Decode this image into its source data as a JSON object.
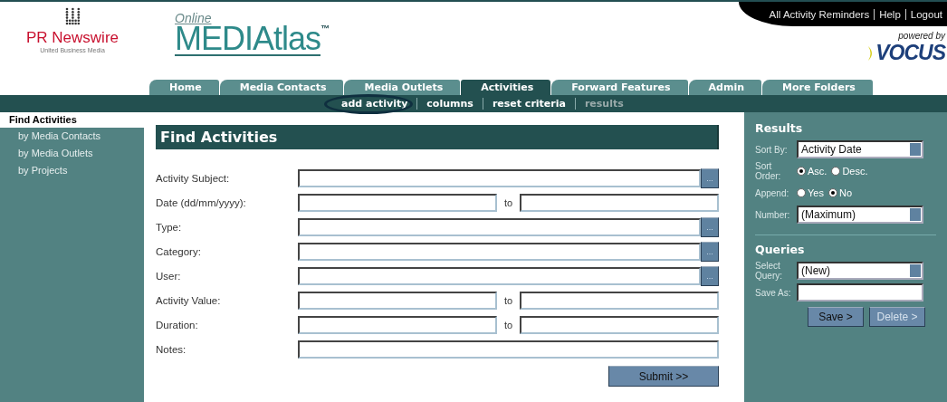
{
  "brand": {
    "company": "PR Newswire",
    "company_sub": "United Business Media",
    "product_prefix": "Online",
    "product_name": "MEDIAtlas",
    "trademark": "™",
    "powered_by": "powered by",
    "partner": "VOCUS"
  },
  "top_links": [
    "All Activity Reminders",
    "Help",
    "Logout"
  ],
  "tabs": [
    {
      "label": "Home",
      "selected": false
    },
    {
      "label": "Media Contacts",
      "selected": false
    },
    {
      "label": "Media Outlets",
      "selected": false
    },
    {
      "label": "Activities",
      "selected": true
    },
    {
      "label": "Forward Features",
      "selected": false
    },
    {
      "label": "Admin",
      "selected": false
    },
    {
      "label": "More Folders",
      "selected": false
    }
  ],
  "subnav": [
    {
      "label": "add activity",
      "disabled": false,
      "highlighted": true
    },
    {
      "label": "columns",
      "disabled": false,
      "highlighted": false
    },
    {
      "label": "reset criteria",
      "disabled": false,
      "highlighted": false
    },
    {
      "label": "results",
      "disabled": true,
      "highlighted": false
    }
  ],
  "sidebar": {
    "title": "Find Activities",
    "items": [
      "by Media Contacts",
      "by Media Outlets",
      "by Projects"
    ]
  },
  "form": {
    "title": "Find Activities",
    "rows": [
      {
        "kind": "lookup",
        "label": "Activity Subject:",
        "lookup": "..."
      },
      {
        "kind": "range",
        "label": "Date (dd/mm/yyyy):",
        "joiner": "to"
      },
      {
        "kind": "lookup",
        "label": "Type:",
        "lookup": "..."
      },
      {
        "kind": "lookup",
        "label": "Category:",
        "lookup": "..."
      },
      {
        "kind": "lookup",
        "label": "User:",
        "lookup": "..."
      },
      {
        "kind": "range",
        "label": "Activity Value:",
        "joiner": "to"
      },
      {
        "kind": "range",
        "label": "Duration:",
        "joiner": "to"
      },
      {
        "kind": "text",
        "label": "Notes:"
      }
    ],
    "submit": "Submit >>"
  },
  "results": {
    "title": "Results",
    "rows": [
      {
        "kind": "select",
        "label": "Sort By:",
        "value": "Activity Date"
      },
      {
        "kind": "radio",
        "label": "Sort Order:",
        "options": [
          {
            "label": "Asc.",
            "selected": true
          },
          {
            "label": "Desc.",
            "selected": false
          }
        ]
      },
      {
        "kind": "radio",
        "label": "Append:",
        "options": [
          {
            "label": "Yes",
            "selected": false
          },
          {
            "label": "No",
            "selected": true
          }
        ]
      },
      {
        "kind": "select",
        "label": "Number:",
        "value": "(Maximum)"
      }
    ]
  },
  "queries": {
    "title": "Queries",
    "rows": [
      {
        "kind": "select",
        "label": "Select Query:",
        "value": "(New)"
      },
      {
        "kind": "input",
        "label": "Save As:"
      }
    ],
    "buttons": [
      {
        "label": "Save >",
        "disabled": false
      },
      {
        "label": "Delete >",
        "disabled": true
      }
    ]
  }
}
